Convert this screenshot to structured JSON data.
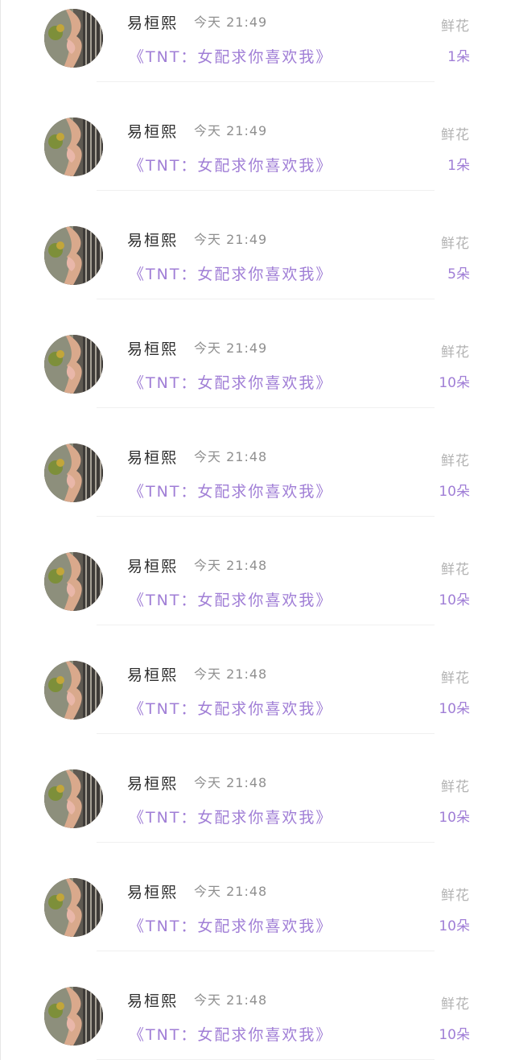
{
  "list": {
    "rows": [
      {
        "name": "易桓熙",
        "time": "今天 21:49",
        "book": "《TNT：女配求你喜欢我》",
        "gift": "鲜花",
        "count": "1朵"
      },
      {
        "name": "易桓熙",
        "time": "今天 21:49",
        "book": "《TNT：女配求你喜欢我》",
        "gift": "鲜花",
        "count": "1朵"
      },
      {
        "name": "易桓熙",
        "time": "今天 21:49",
        "book": "《TNT：女配求你喜欢我》",
        "gift": "鲜花",
        "count": "5朵"
      },
      {
        "name": "易桓熙",
        "time": "今天 21:49",
        "book": "《TNT：女配求你喜欢我》",
        "gift": "鲜花",
        "count": "10朵"
      },
      {
        "name": "易桓熙",
        "time": "今天 21:48",
        "book": "《TNT：女配求你喜欢我》",
        "gift": "鲜花",
        "count": "10朵"
      },
      {
        "name": "易桓熙",
        "time": "今天 21:48",
        "book": "《TNT：女配求你喜欢我》",
        "gift": "鲜花",
        "count": "10朵"
      },
      {
        "name": "易桓熙",
        "time": "今天 21:48",
        "book": "《TNT：女配求你喜欢我》",
        "gift": "鲜花",
        "count": "10朵"
      },
      {
        "name": "易桓熙",
        "time": "今天 21:48",
        "book": "《TNT：女配求你喜欢我》",
        "gift": "鲜花",
        "count": "10朵"
      },
      {
        "name": "易桓熙",
        "time": "今天 21:48",
        "book": "《TNT：女配求你喜欢我》",
        "gift": "鲜花",
        "count": "10朵"
      },
      {
        "name": "易桓熙",
        "time": "今天 21:48",
        "book": "《TNT：女配求你喜欢我》",
        "gift": "鲜花",
        "count": "10朵"
      }
    ]
  },
  "colors": {
    "accent": "#a07ed6",
    "name_text": "#2e2e2e",
    "time_text": "#8f8f8f",
    "gift_text": "#b3b3b3",
    "divider": "#f0f0f0"
  },
  "icons": {
    "avatar": "user-photo-avatar"
  }
}
